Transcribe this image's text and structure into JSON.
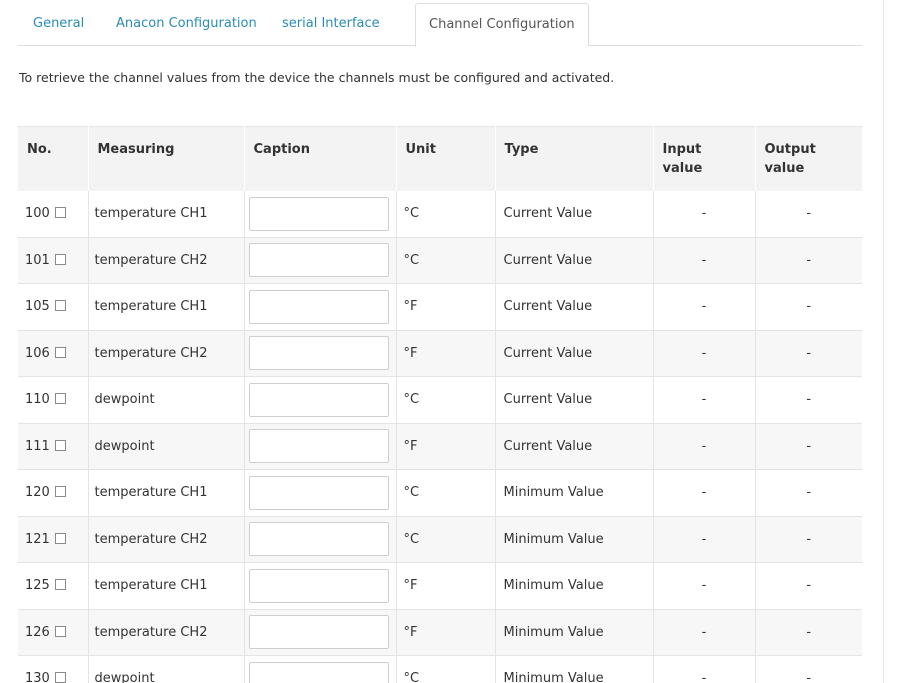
{
  "tabs": [
    {
      "label": "General",
      "active": false
    },
    {
      "label": "Anacon Configuration",
      "active": false
    },
    {
      "label": "serial Interface",
      "active": false
    },
    {
      "label": "Channel Configuration",
      "active": true
    }
  ],
  "intro_text": "To retrieve the channel values from the device the channels must be configured and activated.",
  "table": {
    "headers": [
      "No.",
      "Measuring",
      "Caption",
      "Unit",
      "Type",
      "Input value",
      "Output value"
    ],
    "rows": [
      {
        "no": "100",
        "measuring": "temperature CH1",
        "caption": "",
        "unit": "°C",
        "type": "Current Value",
        "input": "-",
        "output": "-"
      },
      {
        "no": "101",
        "measuring": "temperature CH2",
        "caption": "",
        "unit": "°C",
        "type": "Current Value",
        "input": "-",
        "output": "-"
      },
      {
        "no": "105",
        "measuring": "temperature CH1",
        "caption": "",
        "unit": "°F",
        "type": "Current Value",
        "input": "-",
        "output": "-"
      },
      {
        "no": "106",
        "measuring": "temperature CH2",
        "caption": "",
        "unit": "°F",
        "type": "Current Value",
        "input": "-",
        "output": "-"
      },
      {
        "no": "110",
        "measuring": "dewpoint",
        "caption": "",
        "unit": "°C",
        "type": "Current Value",
        "input": "-",
        "output": "-"
      },
      {
        "no": "111",
        "measuring": "dewpoint",
        "caption": "",
        "unit": "°F",
        "type": "Current Value",
        "input": "-",
        "output": "-"
      },
      {
        "no": "120",
        "measuring": "temperature CH1",
        "caption": "",
        "unit": "°C",
        "type": "Minimum Value",
        "input": "-",
        "output": "-"
      },
      {
        "no": "121",
        "measuring": "temperature CH2",
        "caption": "",
        "unit": "°C",
        "type": "Minimum Value",
        "input": "-",
        "output": "-"
      },
      {
        "no": "125",
        "measuring": "temperature CH1",
        "caption": "",
        "unit": "°F",
        "type": "Minimum Value",
        "input": "-",
        "output": "-"
      },
      {
        "no": "126",
        "measuring": "temperature CH2",
        "caption": "",
        "unit": "°F",
        "type": "Minimum Value",
        "input": "-",
        "output": "-"
      },
      {
        "no": "130",
        "measuring": "dewpoint",
        "caption": "",
        "unit": "°C",
        "type": "Minimum Value",
        "input": "-",
        "output": "-"
      }
    ]
  },
  "colors": {
    "link": "#2a8cb5",
    "header_bg": "#f3f3f3",
    "stripe_bg": "#f7f7f7"
  }
}
